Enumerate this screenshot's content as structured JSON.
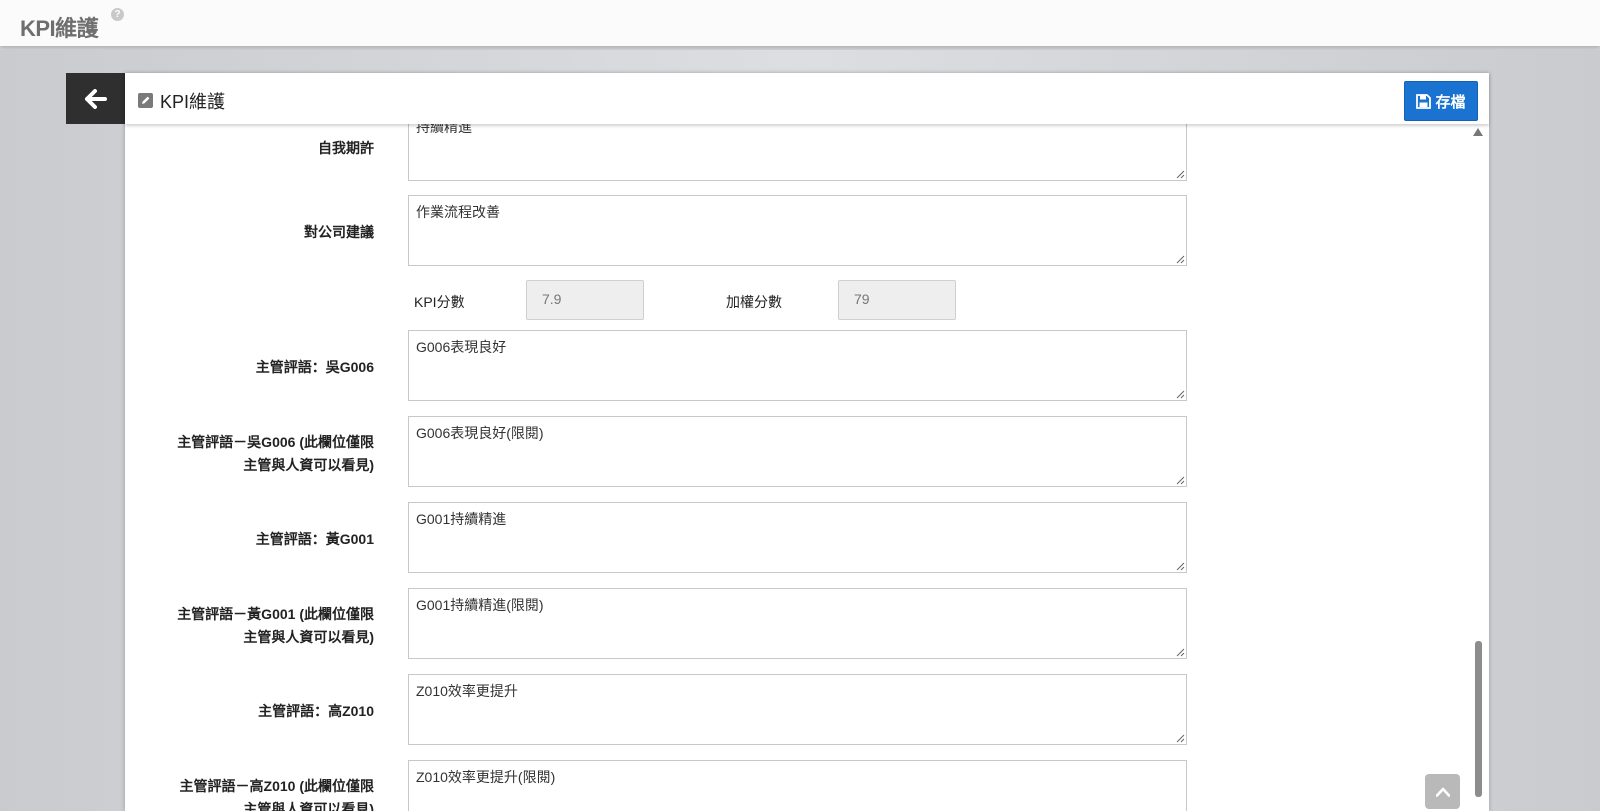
{
  "top_bar": {
    "title": "KPI維護",
    "help_glyph": "?"
  },
  "dialog": {
    "title": "KPI維護",
    "save_label": "存檔",
    "fields": [
      {
        "label": "自我期許",
        "value": "持續精進"
      },
      {
        "label": "對公司建議",
        "value": "作業流程改善"
      },
      {
        "label": "主管評語：吳G006",
        "value": "G006表現良好"
      },
      {
        "label_line1": "主管評語－吳G006 (此欄位僅限",
        "label_line2": "主管與人資可以看見)",
        "value": "G006表現良好(限閱)"
      },
      {
        "label": "主管評語：黃G001",
        "value": "G001持續精進"
      },
      {
        "label_line1": "主管評語－黃G001 (此欄位僅限",
        "label_line2": "主管與人資可以看見)",
        "value": "G001持續精進(限閱)"
      },
      {
        "label": "主管評語：高Z010",
        "value": "Z010效率更提升"
      },
      {
        "label_line1": "主管評語－高Z010 (此欄位僅限",
        "label_line2": "主管與人資可以看見)",
        "value": "Z010效率更提升(限閱)"
      }
    ],
    "scores": {
      "kpi_label": "KPI分數",
      "kpi_value": "7.9",
      "weighted_label": "加權分數",
      "weighted_value": "79"
    }
  },
  "icons": [
    "help-icon",
    "back-arrow-icon",
    "edit-icon",
    "save-icon",
    "scroll-up-icon",
    "back-to-top-icon"
  ]
}
